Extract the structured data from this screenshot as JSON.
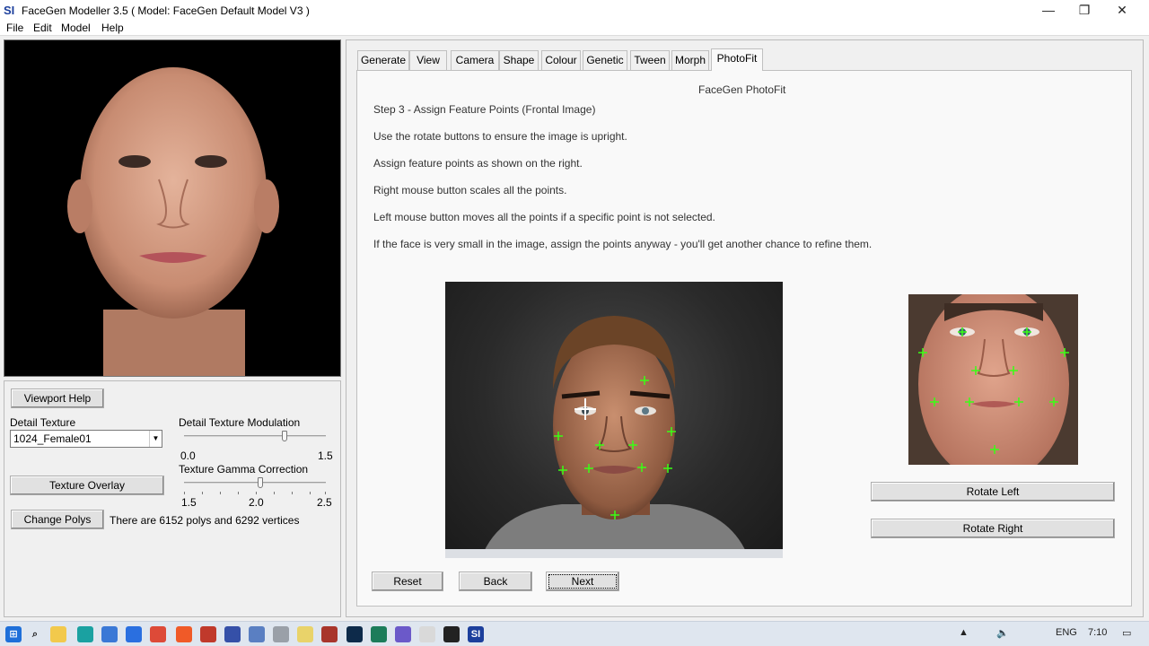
{
  "window": {
    "app_icon": "SI",
    "title": "FaceGen Modeller 3.5  ( Model: FaceGen Default Model V3 )",
    "minimize_glyph": "—",
    "restore_glyph": "❐",
    "close_glyph": "✕"
  },
  "menu": [
    "File",
    "Edit",
    "Model",
    "Help"
  ],
  "left": {
    "viewport_help": "Viewport Help",
    "detail_texture_label": "Detail Texture",
    "detail_texture_value": "1024_Female01",
    "modulation_label": "Detail Texture Modulation",
    "modulation_min": "0.0",
    "modulation_max": "1.5",
    "modulation_value": 0.72,
    "gamma_label": "Texture Gamma Correction",
    "gamma_min": "1.5",
    "gamma_mid": "2.0",
    "gamma_max": "2.5",
    "gamma_value": 0.54,
    "texture_overlay": "Texture Overlay",
    "change_polys": "Change Polys",
    "polys_info": "There are 6152 polys and 6292 vertices"
  },
  "tabs": [
    "Generate",
    "View",
    "Camera",
    "Shape",
    "Colour",
    "Genetic",
    "Tween",
    "Morph",
    "PhotoFit"
  ],
  "active_tab": "PhotoFit",
  "photofit": {
    "heading": "FaceGen PhotoFit",
    "step": "Step 3 - Assign Feature Points (Frontal Image)",
    "instructions": [
      "Use the rotate buttons to ensure the image is upright.",
      "Assign feature points as shown on the right.",
      "Right mouse button scales all the points.",
      "Left mouse button moves all the points if a specific point is not selected.",
      "If the face is very small in the image, assign the points anyway - you'll get another chance to refine them."
    ],
    "rotate_left": "Rotate Left",
    "rotate_right": "Rotate Right",
    "reset": "Reset",
    "back": "Back",
    "next": "Next"
  },
  "taskbar": {
    "lang": "ENG",
    "time": "7:10",
    "icons": [
      "windows-start-icon",
      "search-icon",
      "file-explorer-icon",
      "edge-icon",
      "store-icon",
      "bolt-icon",
      "chrome-icon",
      "brave-icon",
      "app-icon",
      "vivaldi-icon",
      "notes-icon",
      "tool-icon",
      "notepad-icon",
      "app-icon-2",
      "photoshop-icon",
      "app-icon-3",
      "app-icon-4",
      "app-icon-5",
      "app-icon-6",
      "facegen-icon"
    ]
  },
  "colors": {
    "accent_green": "#39ff14",
    "title_icon": "#1c3f9c"
  }
}
